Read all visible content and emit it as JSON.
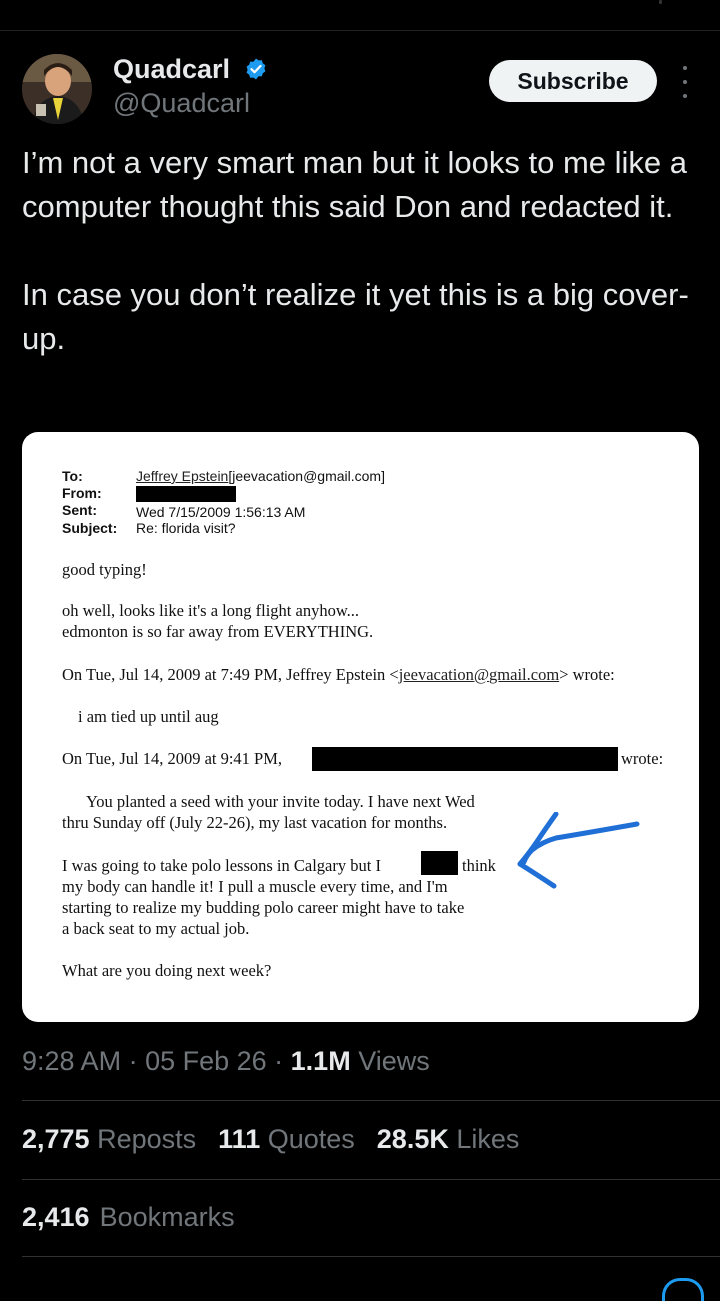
{
  "author": {
    "name": "Quadcarl",
    "handle": "@Quadcarl",
    "verified": true
  },
  "subscribe_label": "Subscribe",
  "tweet": {
    "paragraph1": "I’m not a very smart man but it looks to me like a computer thought this said Don and redacted it.",
    "paragraph2": "In case you don’t realize it yet this is a big cover-up."
  },
  "email": {
    "to_label": "To:",
    "to_value_name": "Jeffrey Epstein",
    "to_value_addr": "[jeevacation@gmail.com]",
    "from_label": "From:",
    "sent_label": "Sent:",
    "sent_value": "Wed 7/15/2009 1:56:13 AM",
    "subject_label": "Subject:",
    "subject_value": "Re: florida visit?",
    "line1": "good typing!",
    "line2": "oh well, looks like it's a long flight anyhow...",
    "line3": "edmonton is so far away from EVERYTHING.",
    "quote1_prefix": "On Tue, Jul 14, 2009 at 7:49 PM, Jeffrey Epstein <",
    "quote1_link1": "jeevacation",
    "quote1_at": "@",
    "quote1_link2": "gmail.com",
    "quote1_suffix": "> wrote:",
    "quote1_body": "i am tied up until aug",
    "quote2_prefix": "On Tue, Jul 14, 2009 at 9:41 PM,",
    "quote2_suffix": "wrote:",
    "body1a": "You planted a seed with your invite today. I have next Wed",
    "body1b": "thru Sunday off (July 22-26), my last vacation for months.",
    "body2a_pre": "I was going to take polo lessons in Calgary but I",
    "body2a_post": "think",
    "body2b": "my body can handle it! I pull a muscle every time, and I'm",
    "body2c": "starting to realize my budding polo career might have to take",
    "body2d": "a back seat to my actual job.",
    "body3": "What are you doing next week?"
  },
  "meta": {
    "time": "9:28 AM",
    "dot1": " · ",
    "date": "05 Feb 26",
    "dot2": " · ",
    "views_count": "1.1M",
    "views_label": " Views"
  },
  "stats": {
    "reposts_count": "2,775",
    "reposts_label": " Reposts",
    "quotes_count": "111",
    "quotes_label": " Quotes",
    "likes_count": "28.5K",
    "likes_label": " Likes",
    "bookmarks_count": "2,416",
    "bookmarks_label": "Bookmarks"
  },
  "colors": {
    "background": "#000000",
    "text": "#e7e9ea",
    "secondary": "#71767b",
    "verified": "#1d9bf0",
    "annotation_arrow": "#1f6fd6"
  },
  "icons": [
    "verified-badge-icon",
    "more-options-icon",
    "arrow-annotation"
  ]
}
